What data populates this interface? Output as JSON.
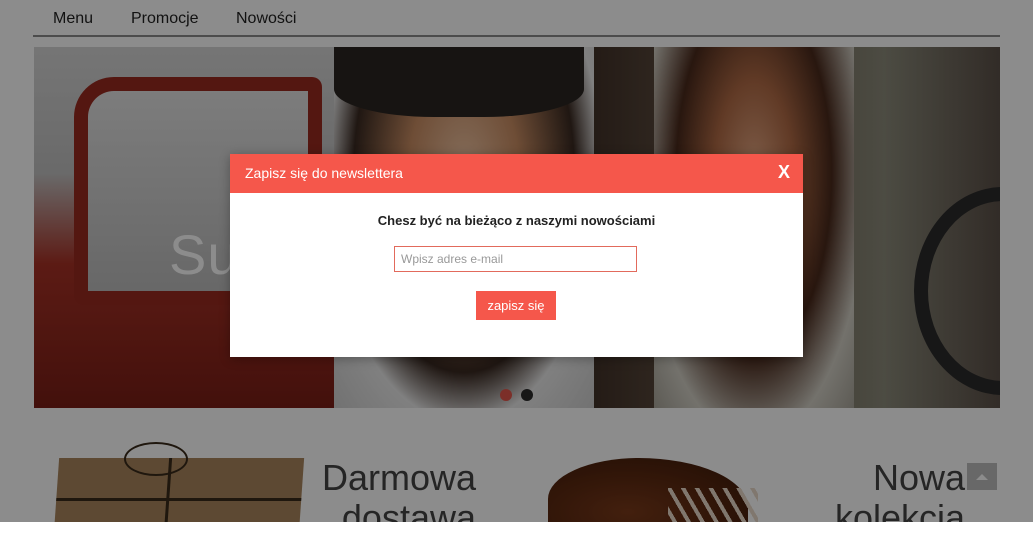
{
  "nav": {
    "items": [
      {
        "label": "Menu"
      },
      {
        "label": "Promocje"
      },
      {
        "label": "Nowości"
      }
    ]
  },
  "hero": {
    "text": "Su",
    "slides": 2,
    "active_slide": 1
  },
  "promos": [
    {
      "title": "Darmowa dostawa"
    },
    {
      "title": "Nowa kolekcja"
    }
  ],
  "newsletter": {
    "title": "Zapisz się do newslettera",
    "close_label": "X",
    "subtitle": "Chesz być na bieżąco z naszymi nowościami",
    "email_placeholder": "Wpisz adres e-mail",
    "email_value": "",
    "submit_label": "zapisz się"
  },
  "colors": {
    "accent": "#f5574b",
    "overlay": "rgba(0,0,0,0.45)"
  }
}
